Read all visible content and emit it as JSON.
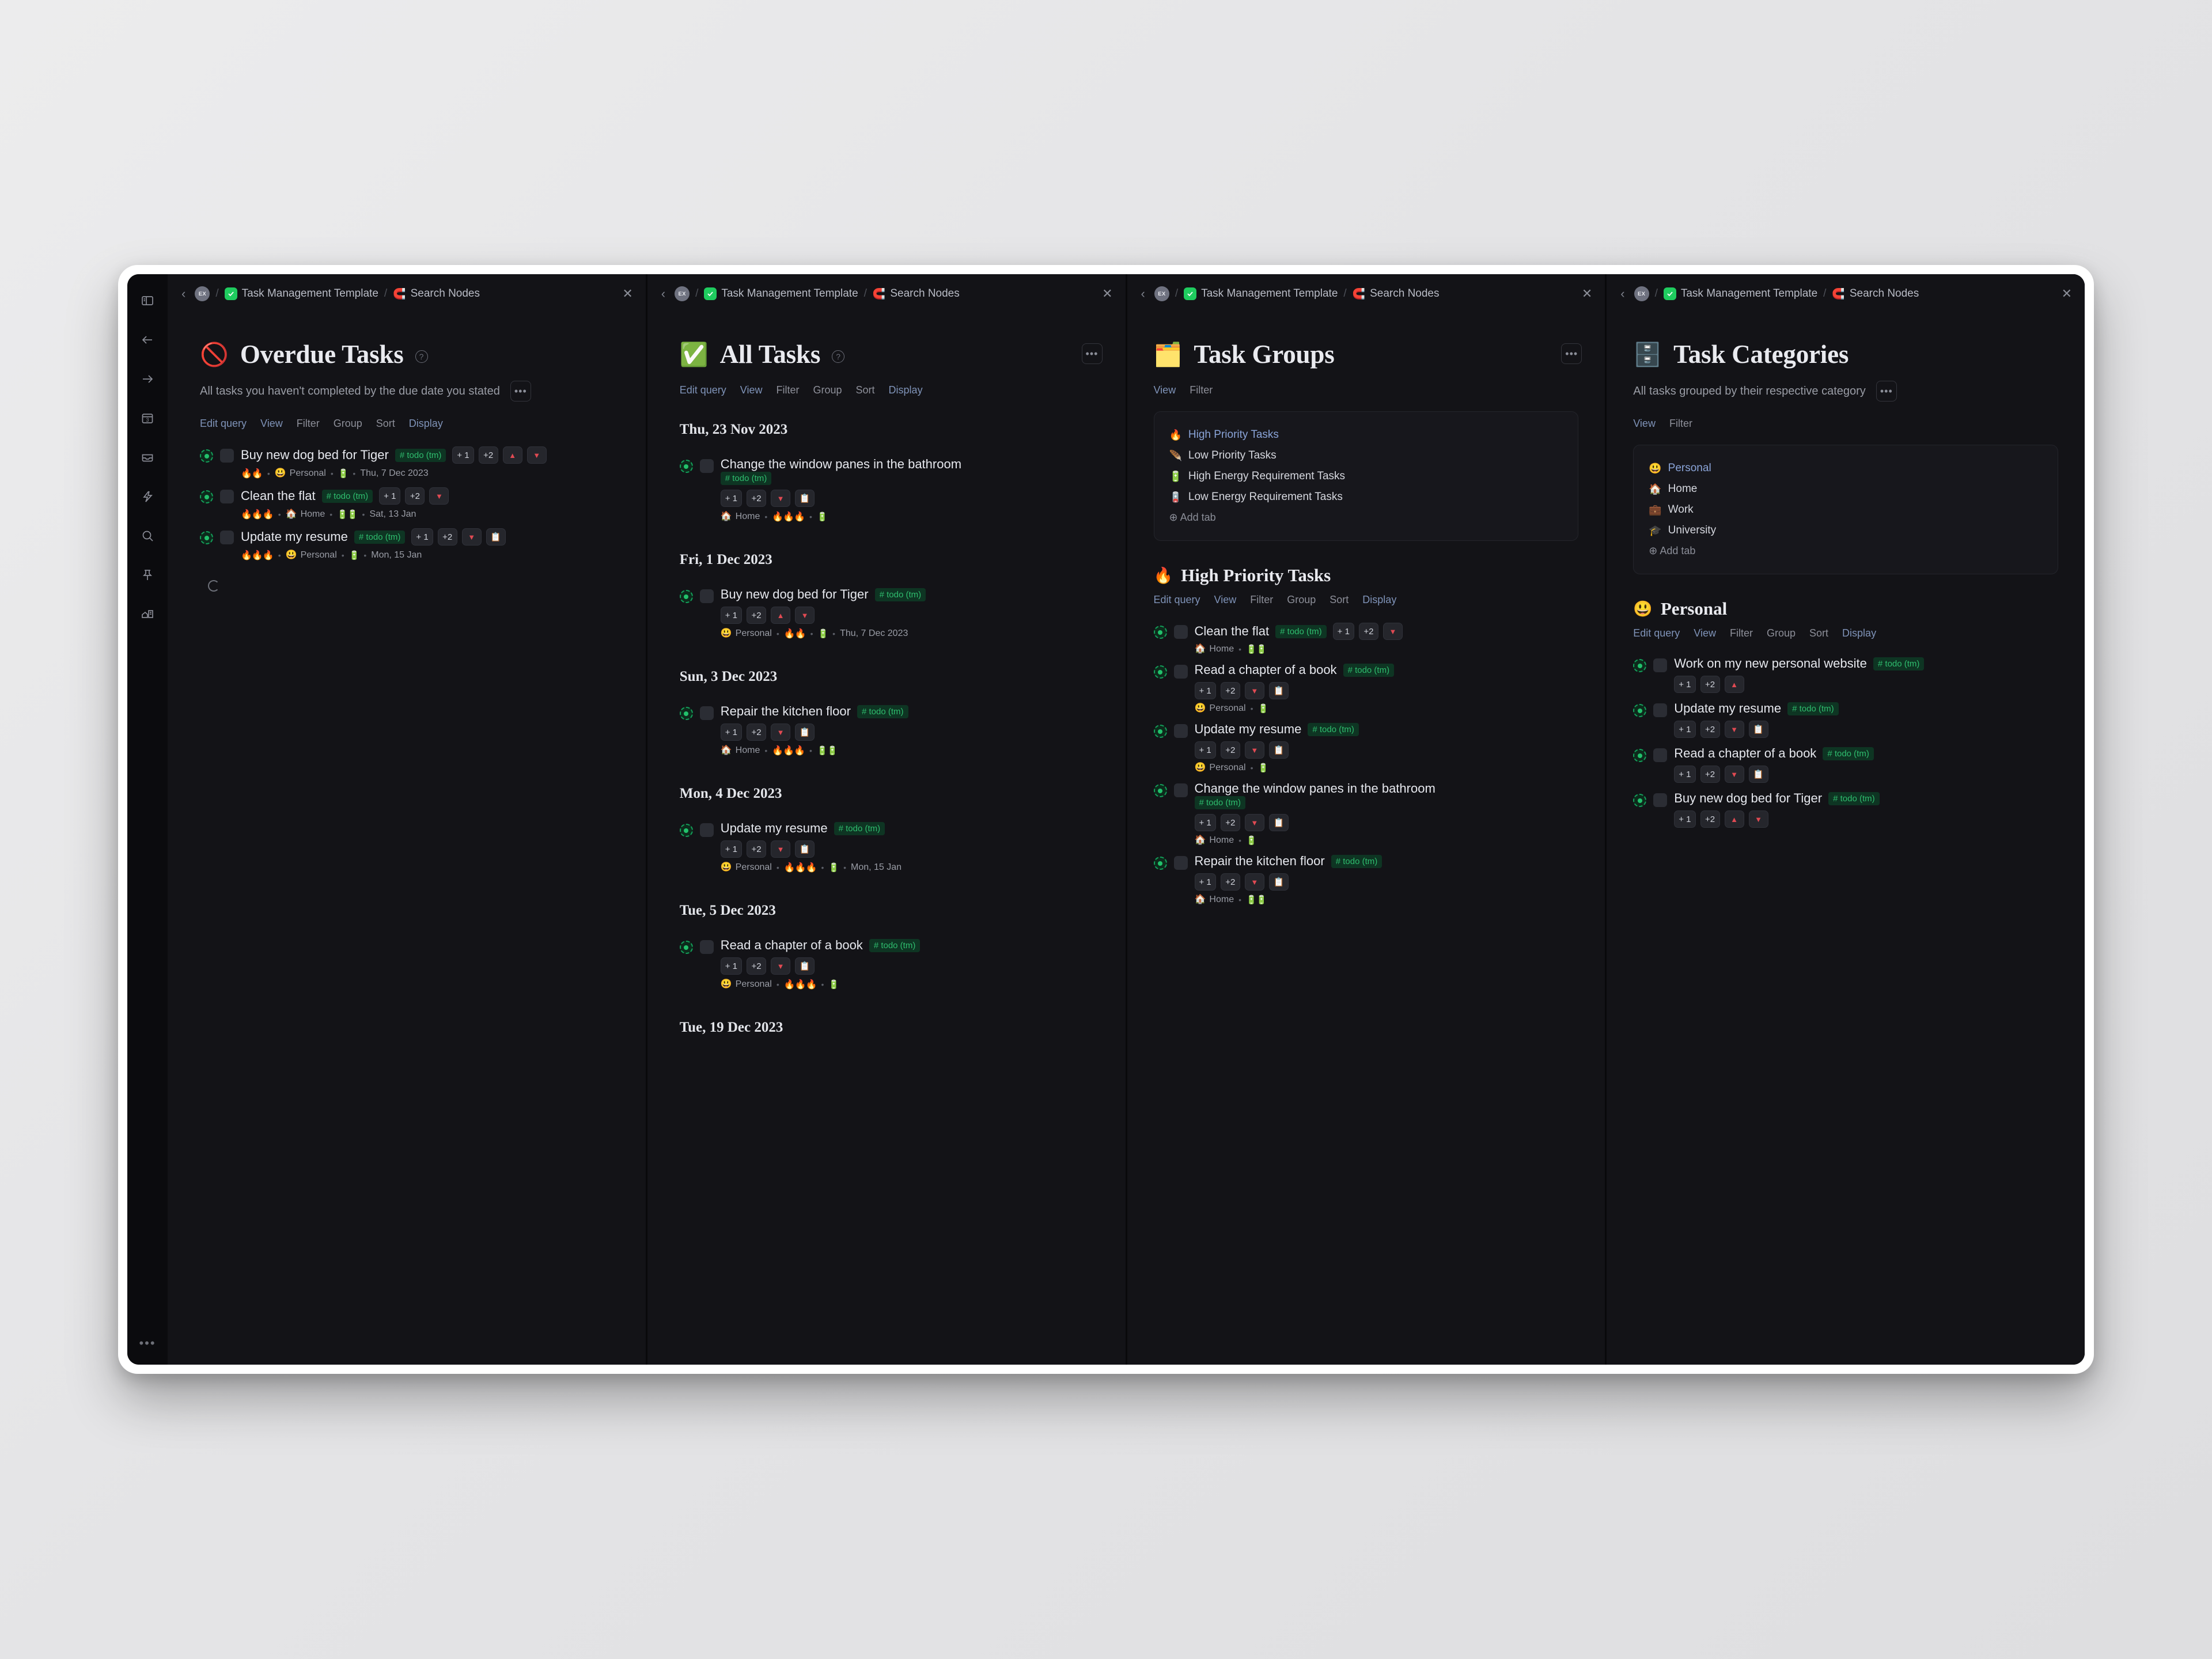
{
  "window": {
    "rail_icons": [
      "sidebar-toggle-icon",
      "back-arrow-icon",
      "forward-arrow-icon",
      "calendar-icon",
      "inbox-icon",
      "lightning-icon",
      "search-icon",
      "pin-icon",
      "graph-icon"
    ],
    "rail_more": "•••"
  },
  "breadcrumb": {
    "avatar": "EX",
    "separator": "/",
    "template": "Task Management Template",
    "search": "Search Nodes",
    "close": "✕",
    "back": "‹"
  },
  "options_full": [
    "Edit query",
    "View",
    "Filter",
    "Group",
    "Sort",
    "Display"
  ],
  "options_short": [
    "View",
    "Filter"
  ],
  "panes": [
    {
      "id": "overdue-tasks",
      "emoji": "🚫",
      "title": "Overdue Tasks",
      "description": "All tasks you haven't completed by the due date you stated",
      "more": "•••",
      "options": [
        "Edit query",
        "View",
        "Filter",
        "Group",
        "Sort",
        "Display"
      ],
      "tasks": [
        {
          "text": "Buy new dog bed for Tiger",
          "tag": "# todo (tm)",
          "chips": [
            "+ 1",
            "+2",
            "▲",
            "▼"
          ],
          "meta": {
            "fires": "🔥🔥",
            "category_emoji": "😃",
            "category": "Personal",
            "energy": "🔋",
            "due": "Thu, 7 Dec 2023"
          }
        },
        {
          "text": "Clean the flat",
          "tag": "# todo (tm)",
          "chips": [
            "+ 1",
            "+2",
            "▼"
          ],
          "meta": {
            "fires": "🔥🔥🔥",
            "category_emoji": "🏠",
            "category": "Home",
            "energy": "🔋🔋",
            "due": "Sat, 13 Jan"
          }
        },
        {
          "text": "Update my resume",
          "tag": "# todo (tm)",
          "chips": [
            "+ 1",
            "+2",
            "▼",
            "📋"
          ],
          "meta": {
            "fires": "🔥🔥🔥",
            "category_emoji": "😃",
            "category": "Personal",
            "energy": "🔋",
            "due": "Mon, 15 Jan"
          }
        }
      ]
    },
    {
      "id": "all-tasks",
      "emoji": "✅",
      "title": "All Tasks",
      "description": "",
      "more": "•••",
      "options": [
        "Edit query",
        "View",
        "Filter",
        "Group",
        "Sort",
        "Display"
      ],
      "date_groups": [
        {
          "date": "Thu, 23 Nov 2023",
          "tasks": [
            {
              "text": "Change the window panes in the bathroom",
              "tag": "# todo (tm)",
              "tag_wrap": true,
              "chips": [
                "+ 1",
                "+2",
                "▼",
                "📋"
              ],
              "meta": {
                "category_emoji": "🏠",
                "category": "Home",
                "fires": "🔥🔥🔥",
                "energy": "🔋",
                "due": ""
              }
            }
          ]
        },
        {
          "date": "Fri, 1 Dec 2023",
          "tasks": [
            {
              "text": "Buy new dog bed for Tiger",
              "tag": "# todo (tm)",
              "chips": [
                "+ 1",
                "+2",
                "▲",
                "▼"
              ],
              "meta": {
                "category_emoji": "😃",
                "category": "Personal",
                "fires": "🔥🔥",
                "energy": "🔋",
                "due": "Thu, 7 Dec 2023"
              }
            }
          ]
        },
        {
          "date": "Sun, 3 Dec 2023",
          "tasks": [
            {
              "text": "Repair the kitchen floor",
              "tag": "# todo (tm)",
              "chips": [
                "+ 1",
                "+2",
                "▼",
                "📋"
              ],
              "meta": {
                "category_emoji": "🏠",
                "category": "Home",
                "fires": "🔥🔥🔥",
                "energy": "🔋🔋",
                "due": ""
              }
            }
          ]
        },
        {
          "date": "Mon, 4 Dec 2023",
          "tasks": [
            {
              "text": "Update my resume",
              "tag": "# todo (tm)",
              "chips": [
                "+ 1",
                "+2",
                "▼",
                "📋"
              ],
              "meta": {
                "category_emoji": "😃",
                "category": "Personal",
                "fires": "🔥🔥🔥",
                "energy": "🔋",
                "due": "Mon, 15 Jan"
              }
            }
          ]
        },
        {
          "date": "Tue, 5 Dec 2023",
          "tasks": [
            {
              "text": "Read a chapter of a book",
              "tag": "# todo (tm)",
              "chips": [
                "+ 1",
                "+2",
                "▼",
                "📋"
              ],
              "meta": {
                "category_emoji": "😃",
                "category": "Personal",
                "fires": "🔥🔥🔥",
                "energy": "🔋",
                "due": ""
              }
            }
          ]
        },
        {
          "date": "Tue, 19 Dec 2023",
          "tasks": []
        }
      ]
    },
    {
      "id": "task-groups",
      "emoji": "🗂️",
      "title": "Task Groups",
      "description": "",
      "more": "•••",
      "options": [
        "View",
        "Filter"
      ],
      "tabs": [
        {
          "emoji": "🔥",
          "label": "High Priority Tasks",
          "active": true
        },
        {
          "emoji": "🪶",
          "label": "Low Priority Tasks",
          "active": false
        },
        {
          "emoji": "🔋",
          "label": "High Energy Requirement Tasks",
          "active": false
        },
        {
          "emoji": "🪫",
          "label": "Low Energy Requirement Tasks",
          "active": false
        }
      ],
      "add_tab": "⊕ Add tab",
      "group": {
        "emoji": "🔥",
        "title": "High Priority Tasks",
        "options": [
          "Edit query",
          "View",
          "Filter",
          "Group",
          "Sort",
          "Display"
        ],
        "tasks": [
          {
            "text": "Clean the flat",
            "tag": "# todo (tm)",
            "chips": [
              "+ 1",
              "+2",
              "▼"
            ],
            "chips_inline": true,
            "meta": {
              "category_emoji": "🏠",
              "category": "Home",
              "energy": "🔋🔋"
            }
          },
          {
            "text": "Read a chapter of a book",
            "tag": "# todo (tm)",
            "chips": [
              "+ 1",
              "+2",
              "▼",
              "📋"
            ],
            "meta": {
              "category_emoji": "😃",
              "category": "Personal",
              "energy": "🔋"
            }
          },
          {
            "text": "Update my resume",
            "tag": "# todo (tm)",
            "chips": [
              "+ 1",
              "+2",
              "▼",
              "📋"
            ],
            "meta": {
              "category_emoji": "😃",
              "category": "Personal",
              "energy": "🔋"
            }
          },
          {
            "text": "Change the window panes in the bathroom",
            "tag": "# todo (tm)",
            "tag_wrap": true,
            "chips": [
              "+ 1",
              "+2",
              "▼",
              "📋"
            ],
            "meta": {
              "category_emoji": "🏠",
              "category": "Home",
              "energy": "🔋"
            }
          },
          {
            "text": "Repair the kitchen floor",
            "tag": "# todo (tm)",
            "chips": [
              "+ 1",
              "+2",
              "▼",
              "📋"
            ],
            "meta": {
              "category_emoji": "🏠",
              "category": "Home",
              "energy": "🔋🔋"
            }
          }
        ]
      }
    },
    {
      "id": "task-categories",
      "emoji": "🗄️",
      "title": "Task Categories",
      "description": "All tasks grouped by their respective category",
      "more": "•••",
      "options": [
        "View",
        "Filter"
      ],
      "tabs": [
        {
          "emoji": "😃",
          "label": "Personal",
          "active": true
        },
        {
          "emoji": "🏠",
          "label": "Home",
          "active": false
        },
        {
          "emoji": "💼",
          "label": "Work",
          "active": false
        },
        {
          "emoji": "🎓",
          "label": "University",
          "active": false
        }
      ],
      "add_tab": "⊕ Add tab",
      "group": {
        "emoji": "😃",
        "title": "Personal",
        "options": [
          "Edit query",
          "View",
          "Filter",
          "Group",
          "Sort",
          "Display"
        ],
        "tasks": [
          {
            "text": "Work on my new personal website",
            "tag": "# todo (tm)",
            "chips": [
              "+ 1",
              "+2",
              "▲"
            ],
            "meta": {}
          },
          {
            "text": "Update my resume",
            "tag": "# todo (tm)",
            "chips": [
              "+ 1",
              "+2",
              "▼",
              "📋"
            ],
            "meta": {}
          },
          {
            "text": "Read a chapter of a book",
            "tag": "# todo (tm)",
            "chips": [
              "+ 1",
              "+2",
              "▼",
              "📋"
            ],
            "meta": {}
          },
          {
            "text": "Buy new dog bed for Tiger",
            "tag": "# todo (tm)",
            "chips": [
              "+ 1",
              "+2",
              "▲",
              "▼"
            ],
            "meta": {}
          }
        ]
      }
    }
  ],
  "colors": {
    "window_bg": "#ffffff",
    "pane_bg": "#131317",
    "pane_gap": "#09090b",
    "rail_bg": "#0b0b0e",
    "accent_green": "#1fcc5f",
    "tag_green": "#2fbd6e",
    "link_blue": "#7f93b8",
    "text_primary": "#e6e8ee",
    "text_muted": "#9a9da6",
    "red": "#e04a53"
  }
}
